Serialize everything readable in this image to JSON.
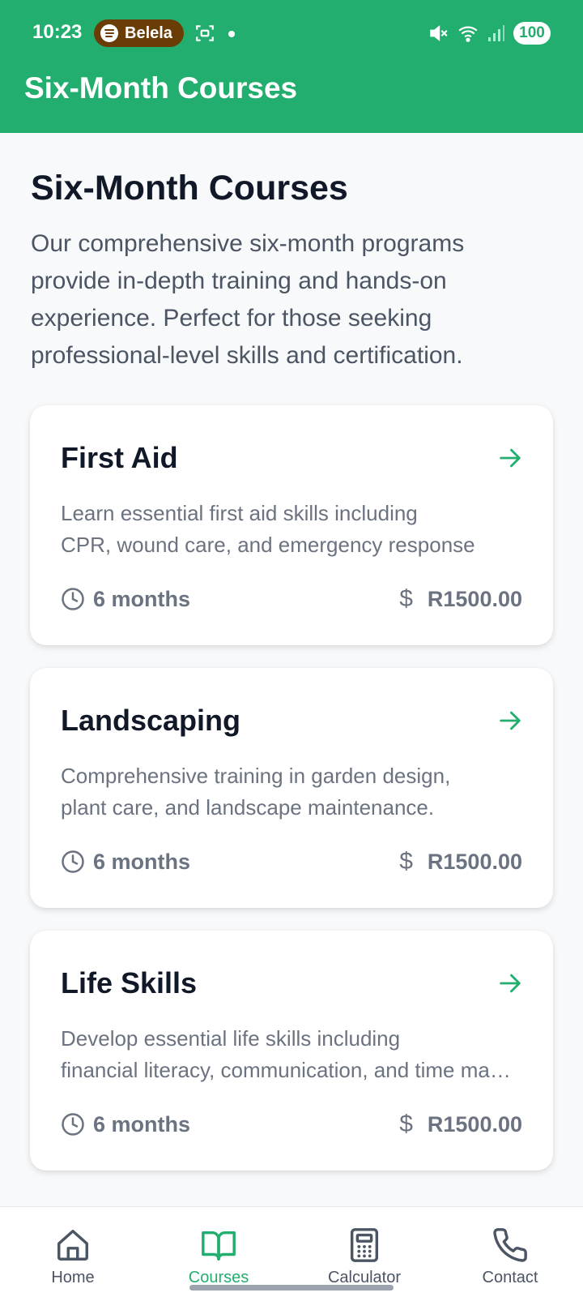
{
  "status_bar": {
    "time": "10:23",
    "media_app": "Belela",
    "battery": "100"
  },
  "app_bar": {
    "title": "Six-Month Courses"
  },
  "intro": {
    "title": "Six-Month Courses",
    "description": "Our comprehensive six-month programs provide in-depth training and hands-on experience. Perfect for those seeking professional-level skills and certification."
  },
  "courses": [
    {
      "title": "First Aid",
      "desc_line1": "Learn essential first aid skills including",
      "desc_line2": "CPR, wound care, and emergency response",
      "duration": "6 months",
      "price": "R1500.00"
    },
    {
      "title": "Landscaping",
      "desc_line1": "Comprehensive training in garden design,",
      "desc_line2": "plant care, and landscape maintenance.",
      "duration": "6 months",
      "price": "R1500.00"
    },
    {
      "title": "Life Skills",
      "desc_line1": "Develop essential life skills including",
      "desc_line2": "financial literacy, communication, and time management",
      "duration": "6 months",
      "price": "R1500.00"
    }
  ],
  "nav": {
    "home": "Home",
    "courses": "Courses",
    "calculator": "Calculator",
    "contact": "Contact",
    "active": "courses"
  },
  "icons": {
    "spotify": "spotify-icon",
    "screen": "screen-record-icon",
    "mute": "vibrate-off-icon",
    "wifi": "wifi-icon",
    "signal": "signal-icon",
    "clock": "clock-icon",
    "dollar": "dollar-icon",
    "arrow": "arrow-right-icon",
    "home": "home-icon",
    "book": "book-open-icon",
    "calculator": "calculator-icon",
    "phone": "phone-icon"
  },
  "colors": {
    "brand": "#22ae6f",
    "title_text": "#111827",
    "body_text": "#4b5563",
    "muted_text": "#6b7280"
  }
}
